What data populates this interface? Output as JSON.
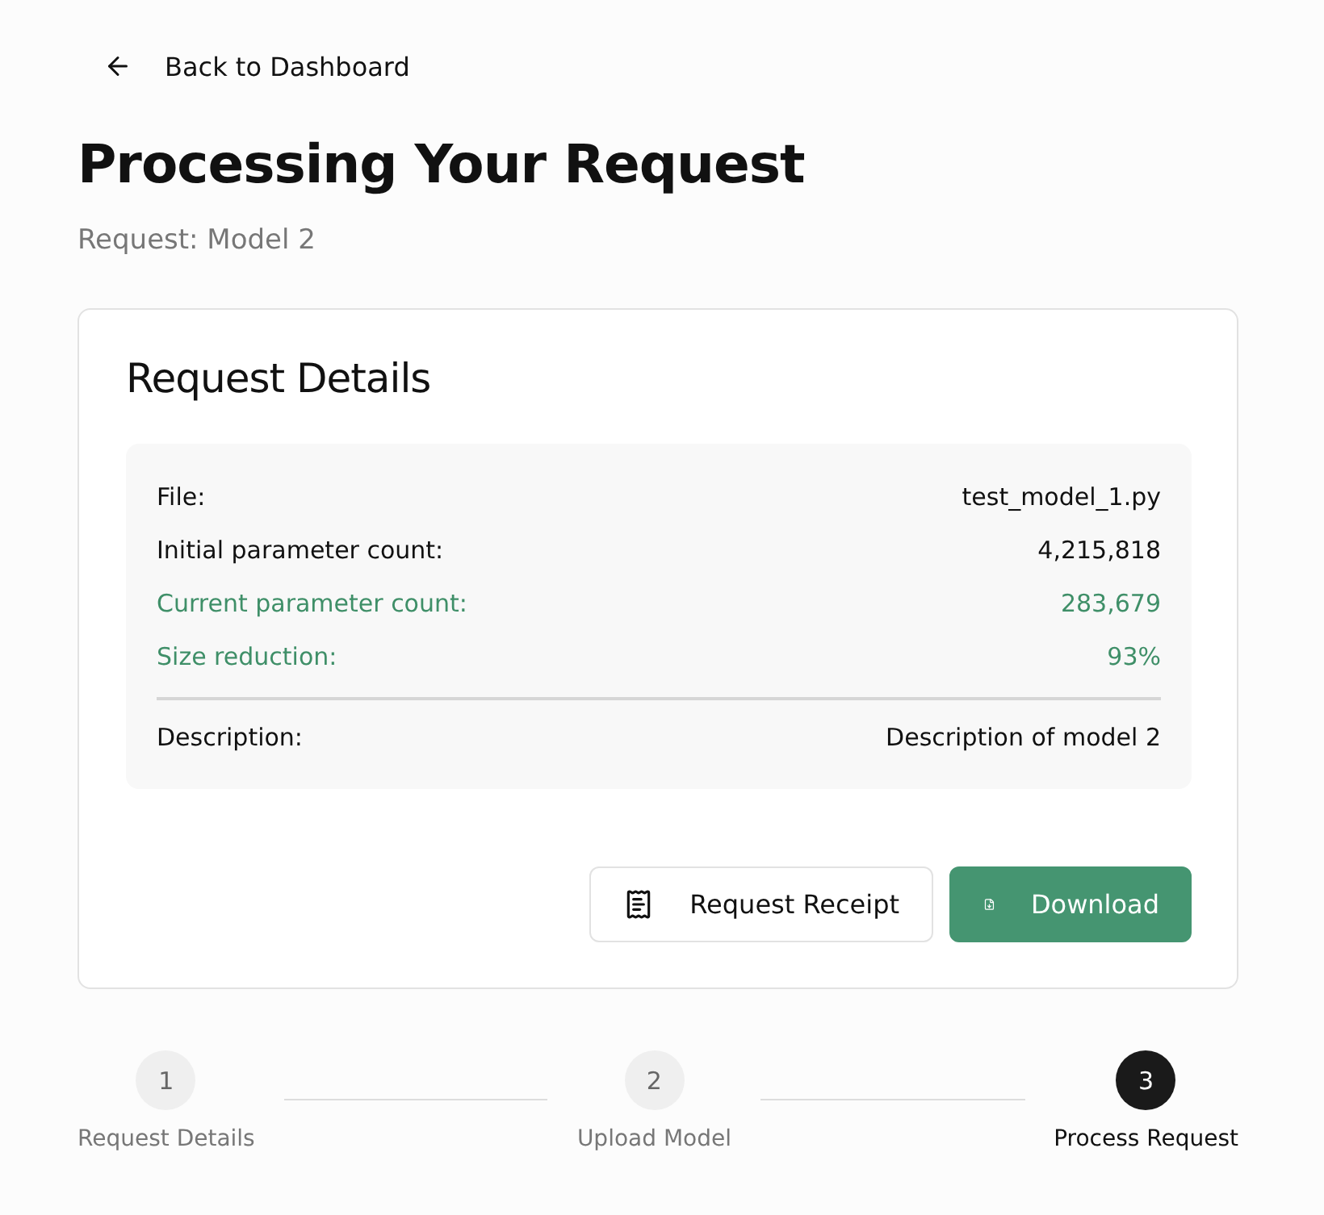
{
  "back_link": {
    "label": "Back to Dashboard"
  },
  "title": "Processing Your Request",
  "subtitle": "Request: Model 2",
  "card": {
    "title": "Request Details",
    "rows": [
      {
        "label": "File:",
        "value": "test_model_1.py",
        "highlighted": false
      },
      {
        "label": "Initial parameter count:",
        "value": "4,215,818",
        "highlighted": false
      },
      {
        "label": "Current parameter count:",
        "value": "283,679",
        "highlighted": true
      },
      {
        "label": "Size reduction:",
        "value": "93%",
        "highlighted": true
      }
    ],
    "description": {
      "label": "Description:",
      "value": "Description of model 2"
    },
    "buttons": [
      {
        "kind": "receipt",
        "label": "Request Receipt"
      },
      {
        "kind": "download",
        "label": "Download"
      }
    ]
  },
  "steps": [
    {
      "number": "1",
      "label": "Request Details",
      "selected": false
    },
    {
      "number": "2",
      "label": "Upload Model",
      "selected": false
    },
    {
      "number": "3",
      "label": "Process Request",
      "selected": true
    }
  ]
}
